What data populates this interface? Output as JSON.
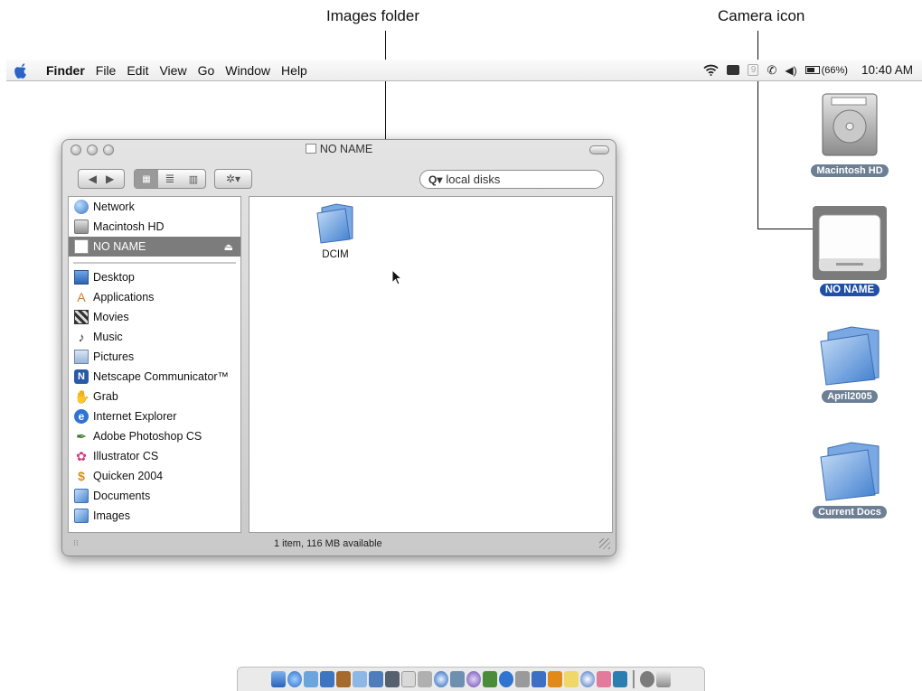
{
  "callouts": {
    "images_folder": "Images folder",
    "camera_icon": "Camera icon"
  },
  "menubar": {
    "app": "Finder",
    "items": [
      "File",
      "Edit",
      "View",
      "Go",
      "Window",
      "Help"
    ],
    "battery": "(66%)",
    "clock": "10:40 AM"
  },
  "window": {
    "title": "NO NAME",
    "search_placeholder": "local disks",
    "sidebar_devices": [
      "Network",
      "Macintosh HD",
      "NO NAME"
    ],
    "sidebar_places": [
      "Desktop",
      "Applications",
      "Movies",
      "Music",
      "Pictures",
      "Netscape Communicator™",
      "Grab",
      "Internet Explorer",
      "Adobe Photoshop CS",
      "Illustrator CS",
      "Quicken 2004",
      "Documents",
      "Images"
    ],
    "file": "DCIM",
    "status": "1 item, 116 MB available"
  },
  "desktop": {
    "icons": [
      "Macintosh HD",
      "NO NAME",
      "April2005",
      "Current Docs"
    ]
  },
  "colors": {
    "selection": "#1f4fa6",
    "sidebar_selected": "#7c7c7c",
    "folder_blue": "#5f95d6"
  }
}
